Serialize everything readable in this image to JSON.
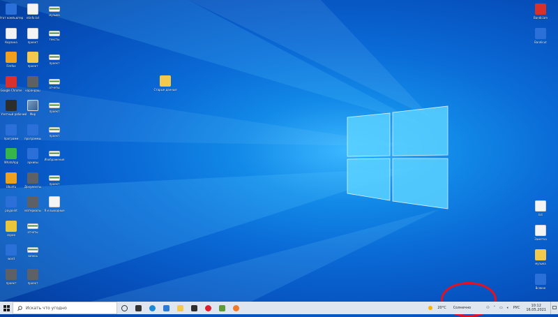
{
  "desktop": {
    "icons_left": [
      {
        "label": "Этот компьютер",
        "glyph": "monitor-icon",
        "style": "g-blue"
      },
      {
        "label": "Корзина",
        "glyph": "recycle-bin-icon",
        "style": "g-white"
      },
      {
        "label": "Firefox",
        "glyph": "firefox-icon",
        "style": "g-orange"
      },
      {
        "label": "Google Chrome",
        "glyph": "chrome-icon",
        "style": "g-red"
      },
      {
        "label": "ПО Учетный рабочий",
        "glyph": "app-icon",
        "style": "g-dark"
      },
      {
        "label": "программ",
        "glyph": "installer-icon",
        "style": "g-blue"
      },
      {
        "label": "WhatsApp",
        "glyph": "whatsapp-icon",
        "style": "g-green"
      },
      {
        "label": "Ubuntu",
        "glyph": "ubuntu-icon",
        "style": "g-orange"
      },
      {
        "label": "paypoint",
        "glyph": "app-icon",
        "style": "g-blue"
      },
      {
        "label": "скрин",
        "glyph": "picture-icon",
        "style": "g-yellow"
      },
      {
        "label": "word",
        "glyph": "document-icon",
        "style": "g-blue"
      },
      {
        "label": "проект",
        "glyph": "image-icon",
        "style": "g-gray"
      }
    ],
    "icons_col2": [
      {
        "label": "ntinfo.txt",
        "glyph": "text-file-icon",
        "style": "g-white"
      },
      {
        "label": "проект",
        "glyph": "text-file-icon",
        "style": "g-white"
      },
      {
        "label": "проект",
        "glyph": "folder-icon",
        "style": "g-folder"
      },
      {
        "label": "карандаш",
        "glyph": "image-icon",
        "style": "g-gray"
      },
      {
        "label": "Мир",
        "glyph": "image-icon",
        "style": "g-img"
      },
      {
        "label": "программы",
        "glyph": "installer-icon",
        "style": "g-blue"
      },
      {
        "label": "архивы",
        "glyph": "installer-icon",
        "style": "g-blue"
      },
      {
        "label": "Документы",
        "glyph": "image-icon",
        "style": "g-gray"
      },
      {
        "label": "материалы",
        "glyph": "image-icon",
        "style": "g-gray"
      },
      {
        "label": "отчеты",
        "glyph": "strip-icon",
        "style": "g-strip"
      },
      {
        "label": "запись",
        "glyph": "strip-icon",
        "style": "g-strip"
      },
      {
        "label": "проект",
        "glyph": "image-icon",
        "style": "g-gray"
      }
    ],
    "icons_col3": [
      {
        "label": "музыка",
        "glyph": "strip-icon",
        "style": "g-strip"
      },
      {
        "label": "тексты",
        "glyph": "strip-icon",
        "style": "g-strip"
      },
      {
        "label": "проект",
        "glyph": "strip-icon",
        "style": "g-strip"
      },
      {
        "label": "отчеты",
        "glyph": "strip-icon",
        "style": "g-strip"
      },
      {
        "label": "проект",
        "glyph": "strip-icon",
        "style": "g-strip"
      },
      {
        "label": "проект",
        "glyph": "strip-icon",
        "style": "g-strip"
      },
      {
        "label": "Изображения",
        "glyph": "strip-icon",
        "style": "g-strip"
      },
      {
        "label": "проект",
        "glyph": "strip-icon",
        "style": "g-strip"
      },
      {
        "label": "Я и выходные",
        "glyph": "text-file-icon",
        "style": "g-white"
      }
    ],
    "center_icon": {
      "label": "Старые данные",
      "glyph": "text-file-icon",
      "style": "g-folder"
    },
    "icons_right": [
      {
        "label": "Bandicam",
        "glyph": "bandicam-icon",
        "style": "g-red"
      },
      {
        "label": "Bandicut",
        "glyph": "bandicut-icon",
        "style": "g-blue"
      },
      {
        "label": "list",
        "glyph": "text-file-icon",
        "style": "g-white"
      },
      {
        "label": "Заметка",
        "glyph": "text-file-icon",
        "style": "g-white"
      },
      {
        "label": "музыка",
        "glyph": "folder-icon",
        "style": "g-folder"
      },
      {
        "label": "Всякое",
        "glyph": "n-app-icon",
        "style": "g-blue"
      }
    ]
  },
  "taskbar": {
    "search_placeholder": "Искать что угодно",
    "apps": [
      {
        "name": "cortana-circle",
        "color": "#333333"
      },
      {
        "name": "task-view",
        "color": "#333333"
      },
      {
        "name": "edge",
        "color": "#1a8ad6"
      },
      {
        "name": "microsoft-store",
        "color": "#2a7ad8"
      },
      {
        "name": "file-explorer",
        "color": "#f2c94c"
      },
      {
        "name": "bag-app",
        "color": "#2f2f2f"
      },
      {
        "name": "opera",
        "color": "#e01d2d"
      },
      {
        "name": "minecraft",
        "color": "#5e9c3a"
      },
      {
        "name": "firefox",
        "color": "#f07a2a"
      }
    ],
    "weather_temp": "20°C",
    "weather_text": "Солнечно",
    "lang": "РУС",
    "time": "10:12",
    "date": "16.05.2021"
  },
  "colors": {
    "desktop_glow": "#3bb7ff",
    "desktop_edge": "#043a9a",
    "annotation_red": "#e8101e",
    "taskbar_bg": "#dfe6ef"
  }
}
